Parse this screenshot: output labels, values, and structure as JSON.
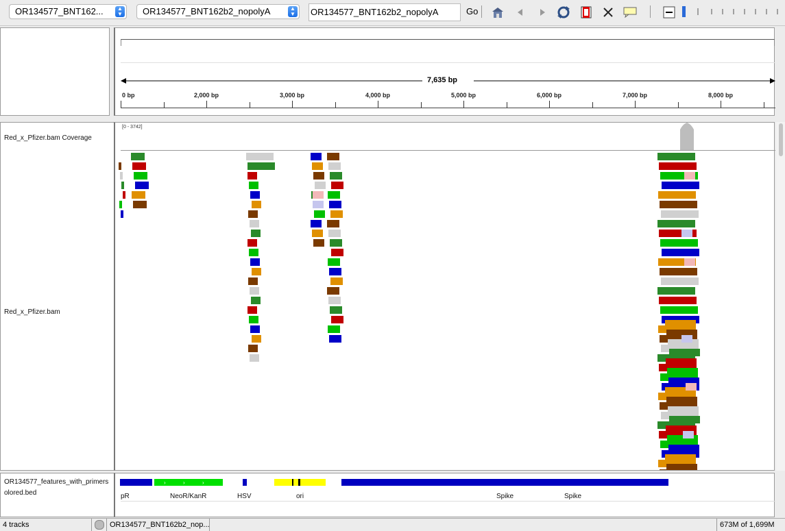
{
  "toolbar": {
    "genome_select": "OR134577_BNT162...",
    "sequence_select": "OR134577_BNT162b2_nopolyA",
    "locus": "OR134577_BNT162b2_nopolyA",
    "go_label": "Go"
  },
  "ruler": {
    "span_label": "7,635 bp",
    "ticks": [
      "0 bp",
      "2,000 bp",
      "3,000 bp",
      "4,000 bp",
      "5,000 bp",
      "6,000 bp",
      "7,000 bp",
      "8,000 bp"
    ]
  },
  "tracks": {
    "coverage_name": "Red_x_Pfizer.bam Coverage",
    "coverage_range": "[0 - 3742]",
    "alignment_name": "Red_x_Pfizer.bam",
    "features_name_line1": "OR134577_features_with_primers",
    "features_name_line2": "olored.bed",
    "feature_labels": [
      "pR",
      "NeoR/KanR",
      "HSV",
      "ori",
      "Spike",
      "Spike"
    ]
  },
  "colors": {
    "feature_blue": "#0000c0",
    "feature_green": "#00e000",
    "feature_yellow": "#ffff00",
    "coverage_gray": "#bdbdbd"
  },
  "status": {
    "tracks": "4 tracks",
    "locus": "OR134577_BNT162b2_nop...",
    "memory": "673M of 1,699M"
  }
}
